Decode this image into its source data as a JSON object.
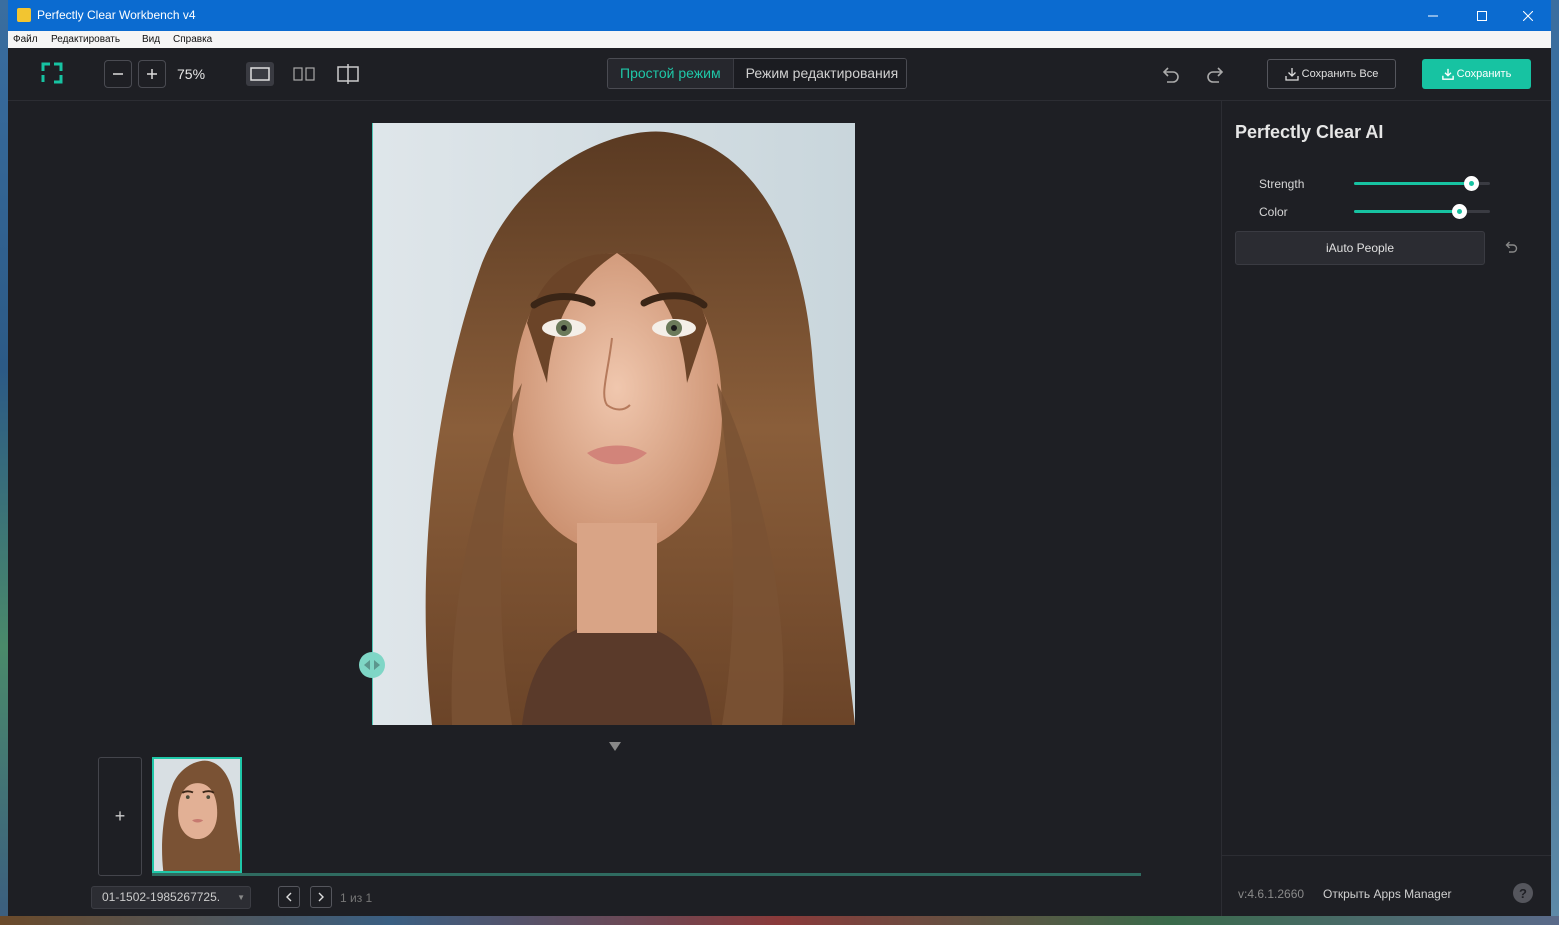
{
  "window": {
    "title": "Perfectly Clear Workbench v4"
  },
  "menu": {
    "items": [
      "Файл",
      "Редактировать",
      "Вид",
      "Справка"
    ]
  },
  "toolbar": {
    "zoom": "75%",
    "modes": {
      "simple": "Простой режим",
      "edit": "Режим редактирования"
    },
    "save_all": "Сохранить Все",
    "save": "Сохранить"
  },
  "filmstrip": {
    "add_label": "+",
    "file_name": "01-1502-1985267725.",
    "page_info": "1 из 1"
  },
  "panel": {
    "title": "Perfectly Clear AI",
    "sliders": [
      {
        "label": "Strength",
        "value": 0.86
      },
      {
        "label": "Color",
        "value": 0.77
      }
    ],
    "preset_button": "iAuto People",
    "version": "v:4.6.1.2660",
    "apps_manager": "Открыть Apps Manager",
    "help": "?"
  },
  "colors": {
    "accent": "#17c3a2",
    "titlebar": "#0b6bd0",
    "background": "#1e1f24"
  }
}
